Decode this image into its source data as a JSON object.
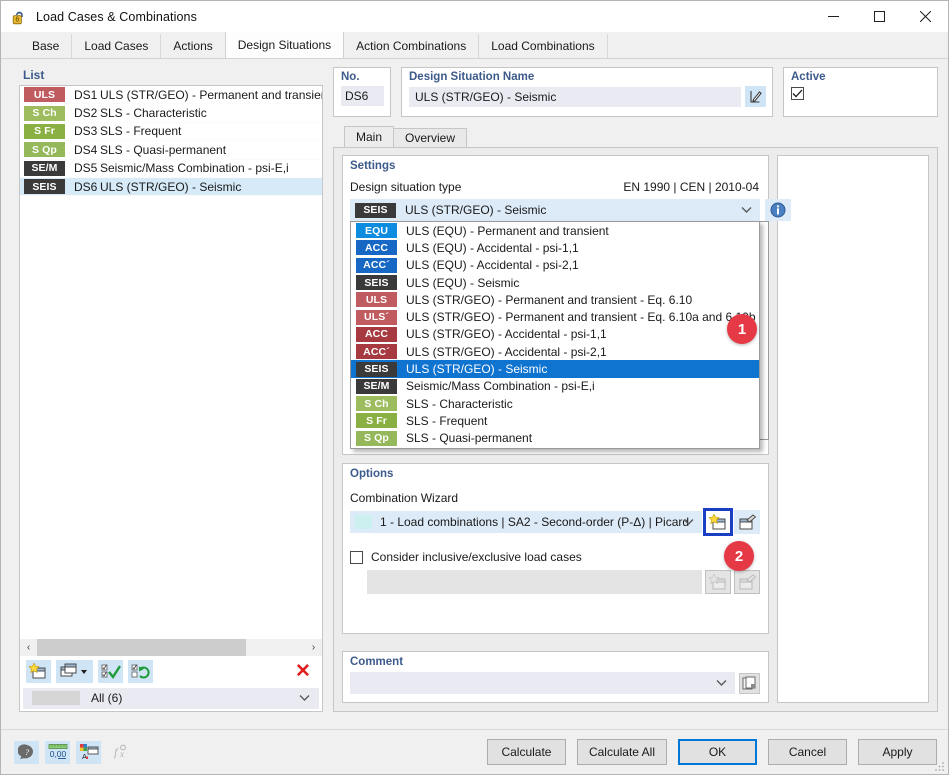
{
  "window": {
    "title": "Load Cases & Combinations",
    "icon": "lock-icon",
    "minimize_label": "–",
    "maximize_label": "□",
    "close_label": "✕"
  },
  "tabs": [
    {
      "label": "Base",
      "active": false
    },
    {
      "label": "Load Cases",
      "active": false
    },
    {
      "label": "Actions",
      "active": false
    },
    {
      "label": "Design Situations",
      "active": true
    },
    {
      "label": "Action Combinations",
      "active": false
    },
    {
      "label": "Load Combinations",
      "active": false
    }
  ],
  "list_panel": {
    "caption": "List",
    "rows": [
      {
        "badge": "ULS",
        "badge_color": "#c05b60",
        "no": "DS1",
        "name": "ULS (STR/GEO) - Permanent and transient - E",
        "selected": false
      },
      {
        "badge": "S Ch",
        "badge_color": "#9dbc5e",
        "no": "DS2",
        "name": "SLS - Characteristic",
        "selected": false
      },
      {
        "badge": "S Fr",
        "badge_color": "#8ab043",
        "no": "DS3",
        "name": "SLS - Frequent",
        "selected": false
      },
      {
        "badge": "S Qp",
        "badge_color": "#94b85a",
        "no": "DS4",
        "name": "SLS - Quasi-permanent",
        "selected": false
      },
      {
        "badge": "SE/M",
        "badge_color": "#3a3a3a",
        "no": "DS5",
        "name": "Seismic/Mass Combination - psi-E,i",
        "selected": false
      },
      {
        "badge": "SEIS",
        "badge_color": "#3a3a3a",
        "no": "DS6",
        "name": "ULS (STR/GEO) - Seismic",
        "selected": true
      }
    ],
    "scroll_left_label": "‹",
    "scroll_right_label": "›",
    "toolbar": [
      {
        "name": "new-design-situation-button",
        "icon": "new-window-star-icon"
      },
      {
        "name": "copy-design-situation-button",
        "icon": "copy-window-dropdown-icon"
      },
      {
        "name": "select-all-button",
        "icon": "checklist-check-icon"
      },
      {
        "name": "invert-selection-button",
        "icon": "checklist-refresh-icon"
      }
    ],
    "delete_label": "✕",
    "filter_value": "All (6)"
  },
  "header_fields": {
    "no_label": "No.",
    "no_value": "DS6",
    "name_label": "Design Situation Name",
    "name_value": "ULS (STR/GEO) - Seismic",
    "edit_icon": "edit-pencil-icon",
    "active_label": "Active",
    "active_checked": true,
    "check_glyph": "✓"
  },
  "inner_tabs": [
    {
      "label": "Main",
      "active": true
    },
    {
      "label": "Overview",
      "active": false
    }
  ],
  "settings": {
    "title": "Settings",
    "type_label": "Design situation type",
    "standard": "EN 1990 | CEN | 2010-04",
    "selected": {
      "badge": "SEIS",
      "badge_color": "#3a3a3a",
      "name": "ULS (STR/GEO) - Seismic"
    },
    "info_icon": "info-circle-icon",
    "chevron": "⌄",
    "dropdown_options": [
      {
        "badge": "EQU",
        "badge_color": "#0c8ce0",
        "name": "ULS (EQU) - Permanent and transient",
        "selected": false
      },
      {
        "badge": "ACC",
        "badge_color": "#1668c4",
        "name": "ULS (EQU) - Accidental - psi-1,1",
        "selected": false
      },
      {
        "badge": "ACC´",
        "badge_color": "#1668c4",
        "name": "ULS (EQU) - Accidental - psi-2,1",
        "selected": false
      },
      {
        "badge": "SEIS",
        "badge_color": "#3a3a3a",
        "name": "ULS (EQU) - Seismic",
        "selected": false
      },
      {
        "badge": "ULS",
        "badge_color": "#c05b60",
        "name": "ULS (STR/GEO) - Permanent and transient - Eq. 6.10",
        "selected": false
      },
      {
        "badge": "ULS´",
        "badge_color": "#c05b60",
        "name": "ULS (STR/GEO) - Permanent and transient - Eq. 6.10a and 6.10b",
        "selected": false
      },
      {
        "badge": "ACC",
        "badge_color": "#a63a40",
        "name": "ULS (STR/GEO) - Accidental - psi-1,1",
        "selected": false
      },
      {
        "badge": "ACC´",
        "badge_color": "#a63a40",
        "name": "ULS (STR/GEO) - Accidental - psi-2,1",
        "selected": false
      },
      {
        "badge": "SEIS",
        "badge_color": "#3a3a3a",
        "name": "ULS (STR/GEO) - Seismic",
        "selected": true
      },
      {
        "badge": "SE/M",
        "badge_color": "#3a3a3a",
        "name": "Seismic/Mass Combination - psi-E,i",
        "selected": false
      },
      {
        "badge": "S Ch",
        "badge_color": "#9dbc5e",
        "name": "SLS - Characteristic",
        "selected": false
      },
      {
        "badge": "S Fr",
        "badge_color": "#8ab043",
        "name": "SLS - Frequent",
        "selected": false
      },
      {
        "badge": "S Qp",
        "badge_color": "#94b85a",
        "name": "SLS - Quasi-permanent",
        "selected": false
      }
    ]
  },
  "options": {
    "title": "Options",
    "wizard_label": "Combination Wizard",
    "wizard_value": "1 - Load combinations | SA2 - Second-order (P-Δ) | Picard",
    "wizard_chevron": "⌄",
    "new_wizard_icon": "new-window-star-icon",
    "edit_wizard_icon": "edit-window-icon",
    "inclusive_label": "Consider inclusive/exclusive load cases",
    "inclusive_checked": false,
    "sub_new_icon": "new-window-star-icon",
    "sub_edit_icon": "edit-window-icon"
  },
  "comment": {
    "title": "Comment",
    "value": "",
    "chevron": "⌄",
    "copy_icon": "copy-pages-icon"
  },
  "markers": [
    {
      "label": "1",
      "color": "#e63946"
    },
    {
      "label": "2",
      "color": "#e63946"
    }
  ],
  "footer": {
    "icons": [
      {
        "name": "help-balloon-icon",
        "enabled": true
      },
      {
        "name": "numeric-units-icon",
        "enabled": true
      },
      {
        "name": "colors-renumber-icon",
        "enabled": true
      },
      {
        "name": "formula-icon",
        "enabled": false
      }
    ],
    "buttons": [
      {
        "label": "Calculate",
        "primary": false
      },
      {
        "label": "Calculate All",
        "primary": false
      },
      {
        "label": "OK",
        "primary": true
      },
      {
        "label": "Cancel",
        "primary": false
      },
      {
        "label": "Apply",
        "primary": false
      }
    ]
  }
}
